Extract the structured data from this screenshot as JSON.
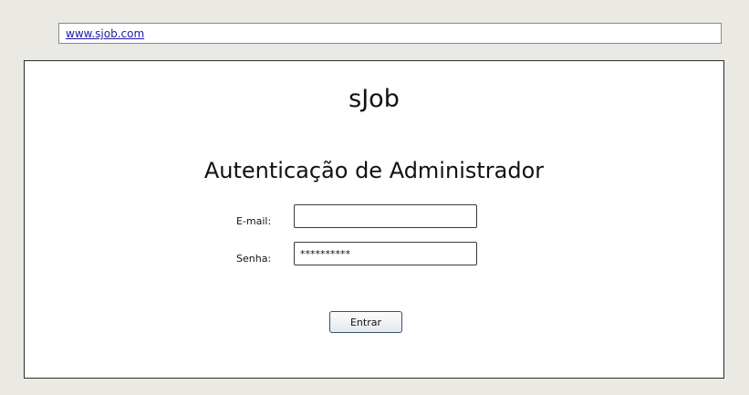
{
  "address_bar": {
    "url_text": "www.sjob.com"
  },
  "app": {
    "title": "sJob"
  },
  "login": {
    "heading": "Autenticação de Administrador",
    "email_label": "E-mail:",
    "email_value": "",
    "password_label": "Senha:",
    "password_value": "**********",
    "submit_label": "Entrar"
  },
  "colors": {
    "background": "#ebe9e3",
    "link": "#1a1aa6",
    "panel": "#ffffff",
    "panel_border": "#2b2b2b"
  }
}
